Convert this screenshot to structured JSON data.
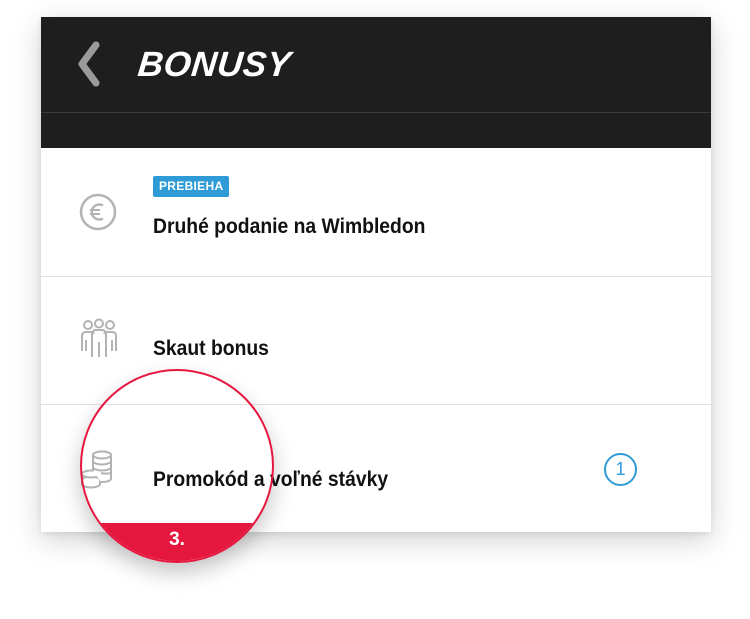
{
  "header": {
    "title": "BONUSY"
  },
  "rows": [
    {
      "badge": "PREBIEHA",
      "title": "Druhé podanie na Wimbledon",
      "icon": "euro-coin-icon"
    },
    {
      "title": "Skaut bonus",
      "icon": "people-group-icon"
    },
    {
      "title": "Promokód a voľné stávky",
      "icon": "coin-stack-icon",
      "count": "1"
    }
  ],
  "step": {
    "label": "3."
  },
  "colors": {
    "header": "#1e1e1e",
    "badge": "#2f9bd6",
    "accent": "#e5173f"
  }
}
